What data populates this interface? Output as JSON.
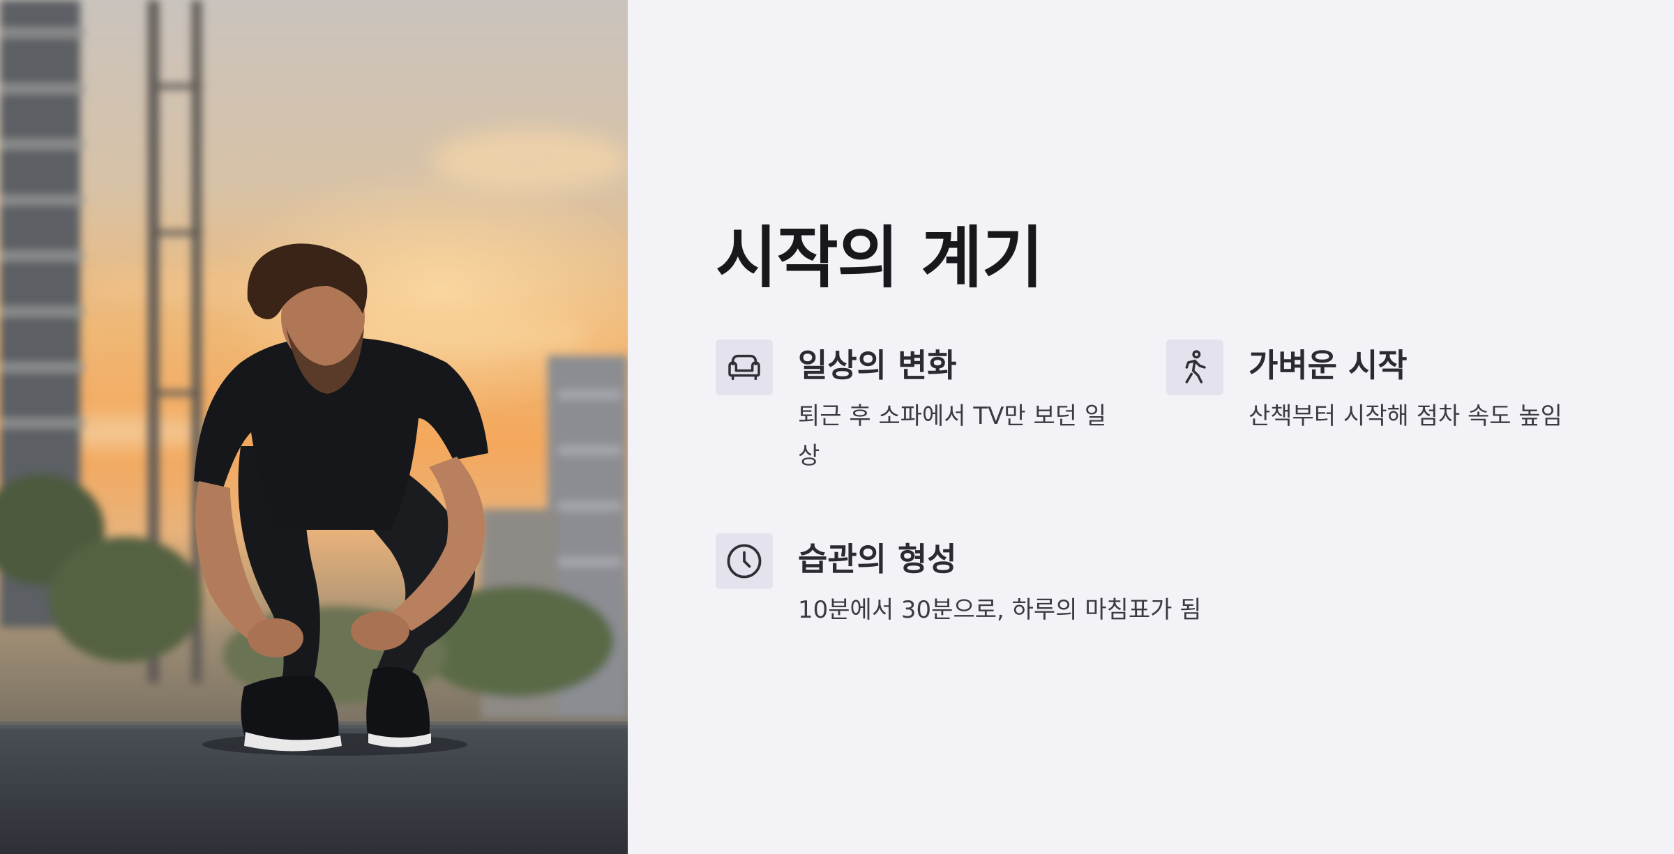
{
  "slide": {
    "title": "시작의 계기",
    "photo_alt": "",
    "features": [
      {
        "icon": "sofa-icon",
        "title": "일상의 변화",
        "description": "퇴근 후 소파에서 TV만 보던 일상"
      },
      {
        "icon": "walking-person-icon",
        "title": "가벼운 시작",
        "description": "산책부터 시작해 점차 속도 높임"
      },
      {
        "icon": "clock-icon",
        "title": "습관의 형성",
        "description": "10분에서 30분으로, 하루의 마침표가 됨"
      }
    ]
  },
  "colors": {
    "background": "#f3f2f7",
    "title": "#17171c",
    "icon_box": "#e4e2ec",
    "text": "#3a3a42"
  }
}
